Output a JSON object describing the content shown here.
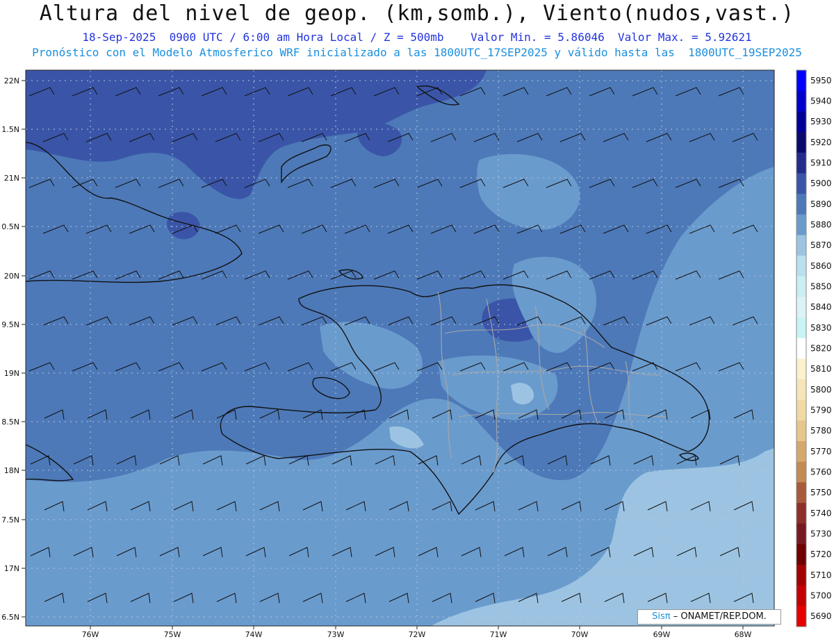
{
  "header": {
    "title": "Altura del nivel de geop. (km,somb.), Viento(nudos,vast.)",
    "subtitle1": "18-Sep-2025  0900 UTC / 6:00 am Hora Local / Z = 500mb    Valor Min. = 5.86046  Valor Max. = 5.92621",
    "subtitle2": "Pronóstico con el Modelo Atmosferico WRF inicializado a las 1800UTC_17SEP2025 y válido hasta las  1800UTC_19SEP2025"
  },
  "axes": {
    "lat_labels": [
      "22N",
      "1.5N",
      "21N",
      "0.5N",
      "20N",
      "9.5N",
      "19N",
      "8.5N",
      "18N",
      "7.5N",
      "17N",
      "6.5N"
    ],
    "lon_labels": [
      "76W",
      "75W",
      "74W",
      "73W",
      "72W",
      "71W",
      "70W",
      "69W",
      "68W"
    ]
  },
  "colorbar": {
    "levels": [
      "5950",
      "5940",
      "5930",
      "5920",
      "5910",
      "5900",
      "5890",
      "5880",
      "5870",
      "5860",
      "5850",
      "5840",
      "5830",
      "5820",
      "5810",
      "5800",
      "5790",
      "5780",
      "5770",
      "5760",
      "5750",
      "5740",
      "5730",
      "5720",
      "5710",
      "5700",
      "5690"
    ],
    "colors": [
      "#0000ff",
      "#0000cc",
      "#000099",
      "#0a0a6e",
      "#232b8c",
      "#3a55a8",
      "#4d79b8",
      "#6a9bcd",
      "#9cc4e2",
      "#b9e0ee",
      "#c9eef4",
      "#dcf3f6",
      "#c8f4f7",
      "#ffffff",
      "#fbf1cc",
      "#f5e5b8",
      "#f0d9a2",
      "#e6c68c",
      "#d4a86e",
      "#c38a54",
      "#a85a3a",
      "#8e2f2a",
      "#761a22",
      "#6e0000",
      "#a30000",
      "#c40000",
      "#e60000"
    ]
  },
  "credit": {
    "sis": "Sisπ",
    "org": "– ONAMET/REP.DOM."
  }
}
